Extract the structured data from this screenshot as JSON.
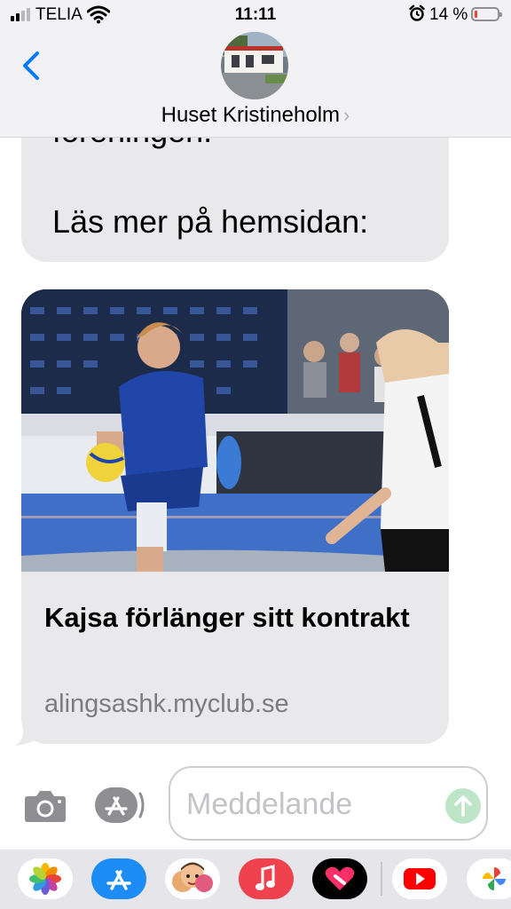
{
  "status_bar": {
    "carrier": "TELIA",
    "time": "11:11",
    "battery_percent": "14 %",
    "battery_level": 0.14,
    "signal_bars": 2,
    "icons": [
      "signal-icon",
      "wifi-icon",
      "alarm-icon",
      "battery-icon"
    ]
  },
  "header": {
    "contact_name": "Huset Kristineholm",
    "chevron": "›",
    "icons": [
      "back-chevron-icon",
      "contact-avatar",
      "chevron-right-icon"
    ]
  },
  "messages": {
    "text_bubble": {
      "line1": "föreningen.",
      "line2": "Läs mer på hemsidan:"
    },
    "link_preview": {
      "title": "Kajsa förlänger sitt kontrakt",
      "url": "alingsashk.myclub.se",
      "image": "handball-player-photo"
    }
  },
  "composer": {
    "placeholder": "Meddelande",
    "icons": [
      "camera-icon",
      "app-store-icon",
      "send-arrow-icon"
    ]
  },
  "app_drawer": {
    "apps": [
      "photos-icon",
      "app-store-icon",
      "memoji-icon",
      "music-icon",
      "fitness-heart-icon",
      "youtube-icon",
      "google-photos-icon"
    ]
  },
  "colors": {
    "accent": "#007aff",
    "bubble": "#e9e9eb",
    "header_bg": "#f2f2f4",
    "battery_low": "#ff3b30",
    "send_disabled": "#bfe5c8"
  }
}
